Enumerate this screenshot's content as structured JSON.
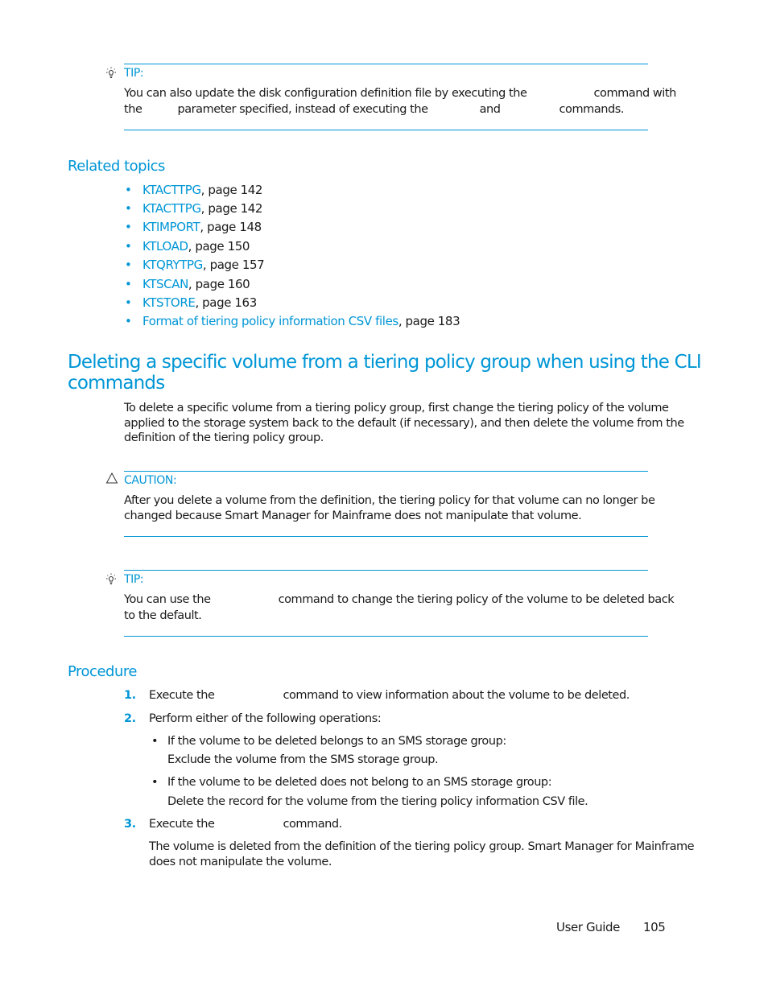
{
  "tip1": {
    "label": "TIP:",
    "line1_a": "You can also update the disk configuration definition file by executing the",
    "line1_b": "command with",
    "line2_a": "the",
    "line2_b": "parameter specified, instead of executing the",
    "line2_c": "and",
    "line2_d": "commands."
  },
  "related": {
    "title": "Related topics",
    "items": [
      {
        "link": "KTACTTPG",
        "suffix": ", page 142"
      },
      {
        "link": "KTACTTPG",
        "suffix": ", page 142"
      },
      {
        "link": "KTIMPORT",
        "suffix": ", page 148"
      },
      {
        "link": "KTLOAD",
        "suffix": ", page 150"
      },
      {
        "link": "KTQRYTPG",
        "suffix": ", page 157"
      },
      {
        "link": "KTSCAN",
        "suffix": ", page 160"
      },
      {
        "link": "KTSTORE",
        "suffix": ", page 163"
      },
      {
        "link": "Format of tiering policy information CSV files",
        "suffix": ", page 183"
      }
    ]
  },
  "section": {
    "title_line1": "Deleting a specific volume from a tiering policy group when using the CLI",
    "title_line2": "commands",
    "intro_line1": "To delete a specific volume from a tiering policy group, first change the tiering policy of the volume",
    "intro_line2": "applied to the storage system back to the default (if necessary), and then delete the volume from the",
    "intro_line3": "definition of the tiering policy group."
  },
  "caution": {
    "label": "CAUTION:",
    "line1": "After you delete a volume from the definition, the tiering policy for that volume can no longer be",
    "line2": "changed because Smart Manager for Mainframe does not manipulate that volume."
  },
  "tip2": {
    "label": "TIP:",
    "line1_a": "You can use the",
    "line1_b": "command to change the tiering policy of the volume to be deleted back",
    "line2": "to the default."
  },
  "procedure": {
    "title": "Procedure",
    "steps": [
      {
        "num": "1.",
        "text_a": "Execute the",
        "text_b": "command to view information about the volume to be deleted."
      },
      {
        "num": "2.",
        "text": "Perform either of the following operations:"
      },
      {
        "num": "3.",
        "text_a": "Execute the",
        "text_b": "command."
      }
    ],
    "options": [
      {
        "bullet": "•",
        "line1": "If the volume to be deleted belongs to an SMS storage group:",
        "line2": "Exclude the volume from the SMS storage group."
      },
      {
        "bullet": "•",
        "line1": "If the volume to be deleted does not belong to an SMS storage group:",
        "line2": "Delete the record for the volume from the tiering policy information CSV file."
      }
    ],
    "result_line1": "The volume is deleted from the definition of the tiering policy group. Smart Manager for Mainframe",
    "result_line2": "does not manipulate the volume."
  },
  "footer": {
    "guide": "User Guide",
    "page": "105"
  },
  "icons": {
    "tip": "lightbulb-icon",
    "caution": "warning-triangle-icon",
    "bullet": "•"
  },
  "colors": {
    "accent": "#0096d6",
    "text": "#1a1a1a"
  }
}
